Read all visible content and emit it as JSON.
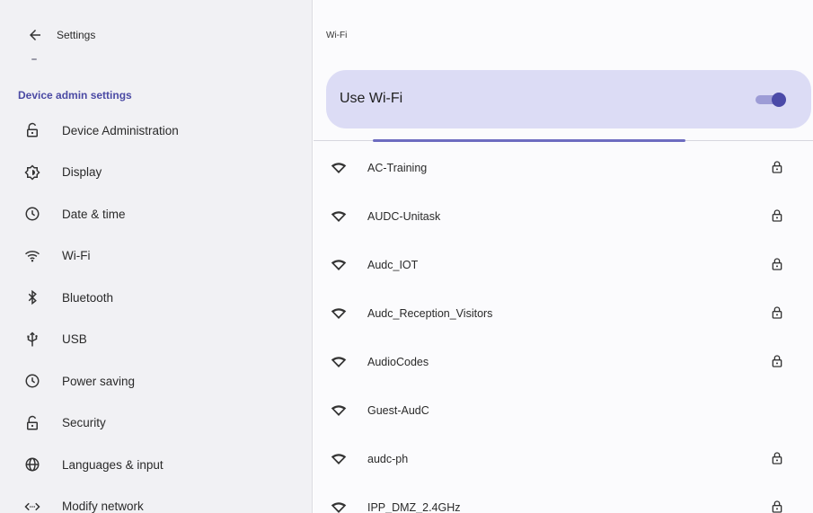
{
  "left": {
    "title": "Settings",
    "section_header": "Device admin settings",
    "items": [
      {
        "label": "Device Administration",
        "icon": "unlock-icon"
      },
      {
        "label": "Display",
        "icon": "brightness-icon"
      },
      {
        "label": "Date & time",
        "icon": "clock-icon"
      },
      {
        "label": "Wi-Fi",
        "icon": "wifi-icon"
      },
      {
        "label": "Bluetooth",
        "icon": "bluetooth-icon"
      },
      {
        "label": "USB",
        "icon": "usb-icon"
      },
      {
        "label": "Power saving",
        "icon": "clock-icon"
      },
      {
        "label": "Security",
        "icon": "unlock-icon"
      },
      {
        "label": "Languages & input",
        "icon": "globe-icon"
      },
      {
        "label": "Modify network",
        "icon": "code-icon"
      }
    ]
  },
  "right": {
    "title": "Wi-Fi",
    "use_wifi_label": "Use Wi-Fi",
    "use_wifi_enabled": true,
    "networks": [
      {
        "name": "AC-Training",
        "secured": true
      },
      {
        "name": "AUDC-Unitask",
        "secured": true
      },
      {
        "name": "Audc_IOT",
        "secured": true
      },
      {
        "name": "Audc_Reception_Visitors",
        "secured": true
      },
      {
        "name": "AudioCodes",
        "secured": true
      },
      {
        "name": "Guest-AudC",
        "secured": false
      },
      {
        "name": "audc-ph",
        "secured": true
      },
      {
        "name": "IPP_DMZ_2.4GHz",
        "secured": true
      }
    ]
  },
  "colors": {
    "accent": "#4b4aa4",
    "card": "#dcdcf5",
    "left_bg": "#f1f1f4"
  }
}
